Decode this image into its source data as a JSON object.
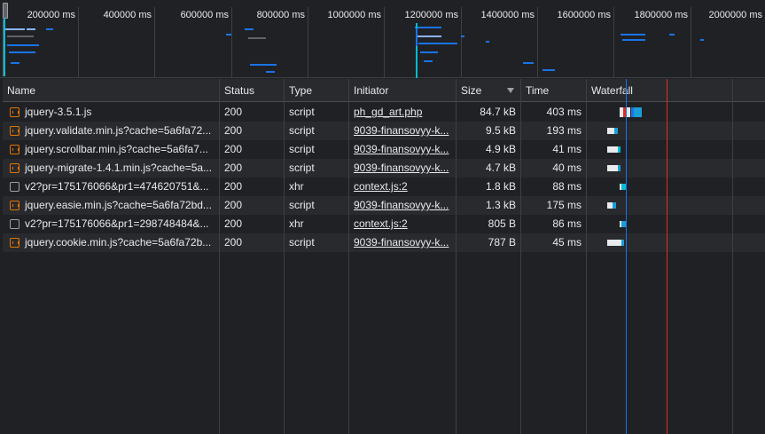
{
  "overview": {
    "ticks": [
      "200000 ms",
      "400000 ms",
      "600000 ms",
      "800000 ms",
      "1000000 ms",
      "1200000 ms",
      "1400000 ms",
      "1600000 ms",
      "1800000 ms",
      "2000000 ms"
    ]
  },
  "columns": {
    "name": "Name",
    "status": "Status",
    "type": "Type",
    "initiator": "Initiator",
    "size": "Size",
    "time": "Time",
    "waterfall": "Waterfall"
  },
  "rows": [
    {
      "name": "jquery-3.5.1.js",
      "icon": "script",
      "status": "200",
      "type": "script",
      "initiator": "ph_gd_art.php",
      "size": "84.7 kB",
      "time": "403 ms"
    },
    {
      "name": "jquery.validate.min.js?cache=5a6fa72...",
      "icon": "script",
      "status": "200",
      "type": "script",
      "initiator": "9039-finansovyy-k...",
      "size": "9.5 kB",
      "time": "193 ms"
    },
    {
      "name": "jquery.scrollbar.min.js?cache=5a6fa7...",
      "icon": "script",
      "status": "200",
      "type": "script",
      "initiator": "9039-finansovyy-k...",
      "size": "4.9 kB",
      "time": "41 ms"
    },
    {
      "name": "jquery-migrate-1.4.1.min.js?cache=5a...",
      "icon": "script",
      "status": "200",
      "type": "script",
      "initiator": "9039-finansovyy-k...",
      "size": "4.7 kB",
      "time": "40 ms"
    },
    {
      "name": "v2?pr=175176066&pr1=474620751&...",
      "icon": "doc",
      "status": "200",
      "type": "xhr",
      "initiator": "context.js:2",
      "size": "1.8 kB",
      "time": "88 ms"
    },
    {
      "name": "jquery.easie.min.js?cache=5a6fa72bd...",
      "icon": "script",
      "status": "200",
      "type": "script",
      "initiator": "9039-finansovyy-k...",
      "size": "1.3 kB",
      "time": "175 ms"
    },
    {
      "name": "v2?pr=175176066&pr1=298748484&...",
      "icon": "doc",
      "status": "200",
      "type": "xhr",
      "initiator": "context.js:2",
      "size": "805 B",
      "time": "86 ms"
    },
    {
      "name": "jquery.cookie.min.js?cache=5a6fa72b...",
      "icon": "script",
      "status": "200",
      "type": "script",
      "initiator": "9039-finansovyy-k...",
      "size": "787 B",
      "time": "45 ms"
    }
  ],
  "colors": {
    "accent_blue": "#1a73e8",
    "cyan": "#00bcd4",
    "red_line": "#d93025"
  }
}
